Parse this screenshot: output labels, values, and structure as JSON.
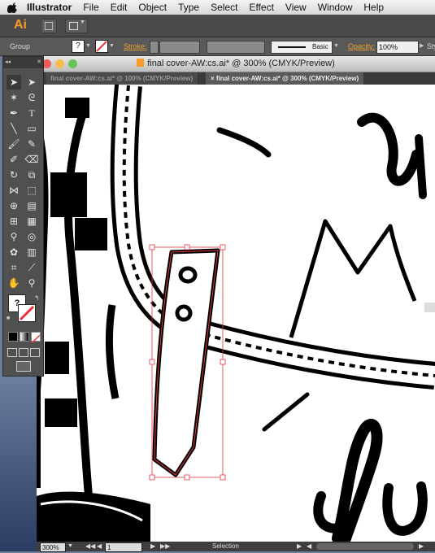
{
  "menubar": {
    "app_name": "Illustrator",
    "items": [
      "File",
      "Edit",
      "Object",
      "Type",
      "Select",
      "Effect",
      "View",
      "Window",
      "Help"
    ]
  },
  "app_bar": {
    "logo": "Ai"
  },
  "control_bar": {
    "selection_label": "Group",
    "stroke_label": "Stroke:",
    "brush_label": "Basic",
    "opacity_label": "Opacity:",
    "opacity_value": "100%",
    "style_label": "Sty"
  },
  "document": {
    "window_title": "final cover-AW:cs.ai* @ 300% (CMYK/Preview)",
    "tabs": [
      {
        "label": "final cover-AW:cs.ai* @ 100% (CMYK/Preview)",
        "active": false
      },
      {
        "label": "final cover-AW:cs.ai* @ 300% (CMYK/Preview)",
        "active": true,
        "close": "×"
      }
    ]
  },
  "status_bar": {
    "zoom": "300%",
    "artboard": "1",
    "current_tool": "Selection"
  },
  "tools_panel": {
    "help_glyph": "?",
    "icons": [
      "selection-icon",
      "direct-selection-icon",
      "magic-wand-icon",
      "lasso-icon",
      "pen-icon",
      "type-icon",
      "line-icon",
      "rectangle-icon",
      "paintbrush-icon",
      "pencil-icon",
      "blob-brush-icon",
      "eraser-icon",
      "rotate-icon",
      "scale-icon",
      "width-icon",
      "free-transform-icon",
      "shape-builder-icon",
      "perspective-grid-icon",
      "mesh-icon",
      "gradient-icon",
      "eyedropper-icon",
      "blend-icon",
      "symbol-sprayer-icon",
      "graph-icon",
      "artboard-icon",
      "slice-icon",
      "hand-icon",
      "zoom-icon"
    ]
  },
  "colors": {
    "accent": "#f79b2a",
    "selection": "#e8323c"
  }
}
